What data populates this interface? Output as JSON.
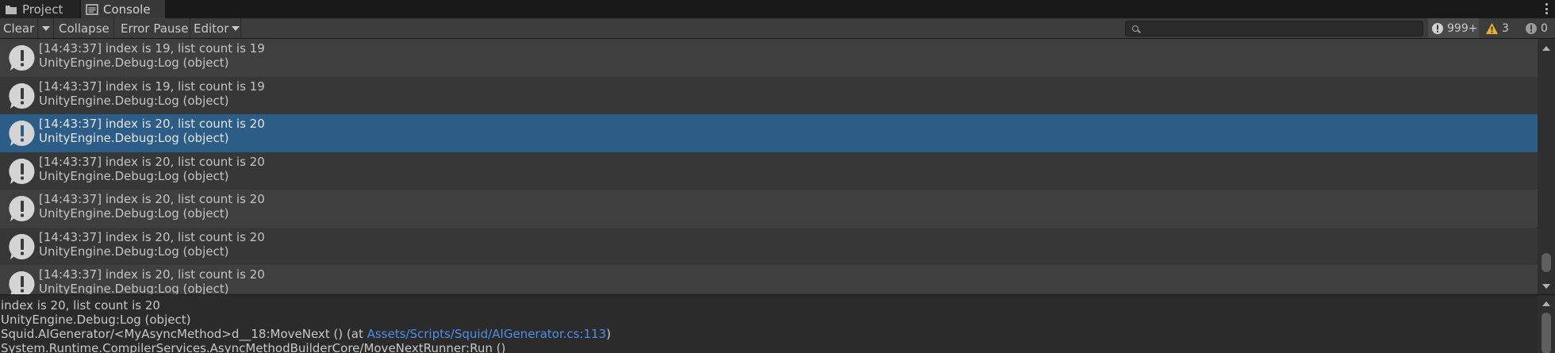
{
  "tabs": [
    {
      "label": "Project",
      "icon": "folder-icon"
    },
    {
      "label": "Console",
      "icon": "console-icon"
    }
  ],
  "toolbar": {
    "clear_label": "Clear",
    "collapse_label": "Collapse",
    "error_pause_label": "Error Pause",
    "editor_label": "Editor",
    "search_value": "",
    "log_count": "999+",
    "warning_count": "3",
    "error_count": "0"
  },
  "log_entries": [
    {
      "message": "[14:43:37] index is 19, list count is 19",
      "source": "UnityEngine.Debug:Log (object)",
      "selected": false
    },
    {
      "message": "[14:43:37] index is 19, list count is 19",
      "source": "UnityEngine.Debug:Log (object)",
      "selected": false
    },
    {
      "message": "[14:43:37] index is 20, list count is 20",
      "source": "UnityEngine.Debug:Log (object)",
      "selected": true
    },
    {
      "message": "[14:43:37] index is 20, list count is 20",
      "source": "UnityEngine.Debug:Log (object)",
      "selected": false
    },
    {
      "message": "[14:43:37] index is 20, list count is 20",
      "source": "UnityEngine.Debug:Log (object)",
      "selected": false
    },
    {
      "message": "[14:43:37] index is 20, list count is 20",
      "source": "UnityEngine.Debug:Log (object)",
      "selected": false
    },
    {
      "message": "[14:43:37] index is 20, list count is 20",
      "source": "UnityEngine.Debug:Log (object)",
      "selected": false
    }
  ],
  "detail": {
    "line1": "index is 20, list count is 20",
    "line2": "UnityEngine.Debug:Log (object)",
    "line3_prefix": "Squid.AIGenerator/<MyAsyncMethod>d__18:MoveNext () (at ",
    "line3_link": "Assets/Scripts/Squid/AIGenerator.cs:113",
    "line3_suffix": ")",
    "line4": "System.Runtime.CompilerServices.AsyncMethodBuilderCore/MoveNextRunner:Run ()"
  },
  "colors": {
    "selected_row": "#2c5d87",
    "link": "#4c8fe6",
    "warning": "#e8b32a"
  }
}
